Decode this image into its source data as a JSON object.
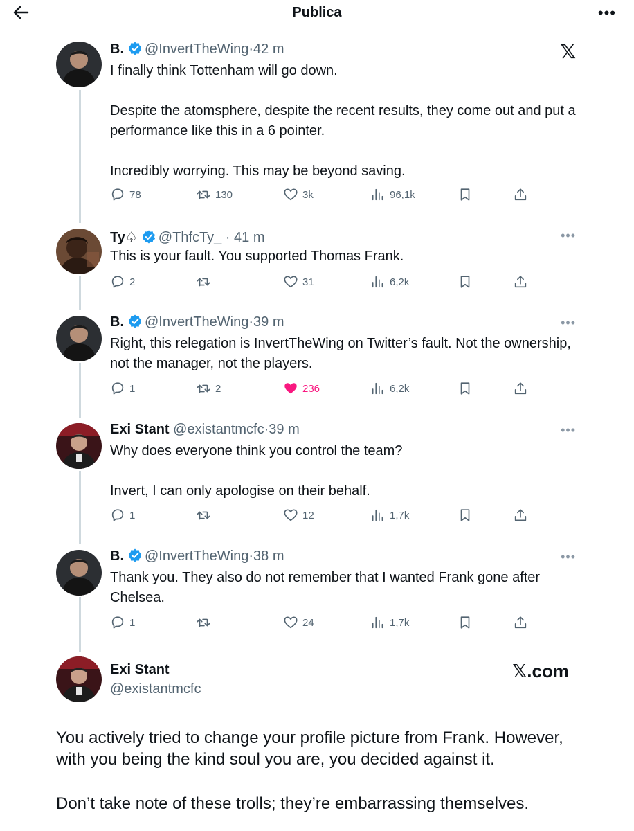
{
  "header": {
    "title": "Publica",
    "more": "•••"
  },
  "tweets": [
    {
      "name": "B.",
      "verified": true,
      "handle": "@InvertTheWing",
      "time": "42 m",
      "paragraphs": [
        "I finally think Tottenham will go down.",
        "Despite the atomsphere, despite the recent results, they come out and put a performance like this in a 6 pointer.",
        "Incredibly worrying. This may be beyond saving."
      ],
      "replies": "78",
      "retweets": "130",
      "likes": "3k",
      "views": "96,1k",
      "liked": false
    },
    {
      "name": "Ty♤",
      "verified": true,
      "handle": "@ThfcTy_",
      "time": "41 m",
      "paragraphs": [
        "This is your fault. You supported Thomas Frank."
      ],
      "replies": "2",
      "retweets": "",
      "likes": "31",
      "views": "6,2k",
      "liked": false
    },
    {
      "name": "B.",
      "verified": true,
      "handle": "@InvertTheWing",
      "time": "39 m",
      "paragraphs": [
        "Right, this relegation is InvertTheWing on Twitter’s fault. Not the ownership, not the manager, not the players."
      ],
      "replies": "1",
      "retweets": "2",
      "likes": "236",
      "views": "6,2k",
      "liked": true
    },
    {
      "name": "Exi Stant",
      "verified": false,
      "handle": "@existantmcfc",
      "time": "39 m",
      "paragraphs": [
        "Why does everyone think you control the team?",
        "Invert, I can only apologise on their behalf."
      ],
      "replies": "1",
      "retweets": "",
      "likes": "12",
      "views": "1,7k",
      "liked": false
    },
    {
      "name": "B.",
      "verified": true,
      "handle": "@InvertTheWing",
      "time": "38 m",
      "paragraphs": [
        "Thank you. They also do not remember that I wanted Frank gone after Chelsea."
      ],
      "replies": "1",
      "retweets": "",
      "likes": "24",
      "views": "1,7k",
      "liked": false
    }
  ],
  "embed": {
    "name": "Exi Stant",
    "handle": "@existantmcfc",
    "brand": "𝕏.com"
  },
  "reply_text": [
    "You actively tried to change your profile picture from Frank. However, with you being the kind soul you are, you decided against it.",
    "Don’t take note of these trolls; they’re embarrassing themselves."
  ],
  "colors": {
    "text": "#0f1419",
    "secondary": "#536471",
    "verified": "#1d9bf0",
    "like_active": "#f91880",
    "thread_line": "#cfd9de"
  },
  "icons": [
    "back-arrow-icon",
    "more-icon",
    "x-logo-icon",
    "verified-badge-icon",
    "reply-icon",
    "retweet-icon",
    "like-icon",
    "views-icon",
    "bookmark-icon",
    "share-icon"
  ]
}
